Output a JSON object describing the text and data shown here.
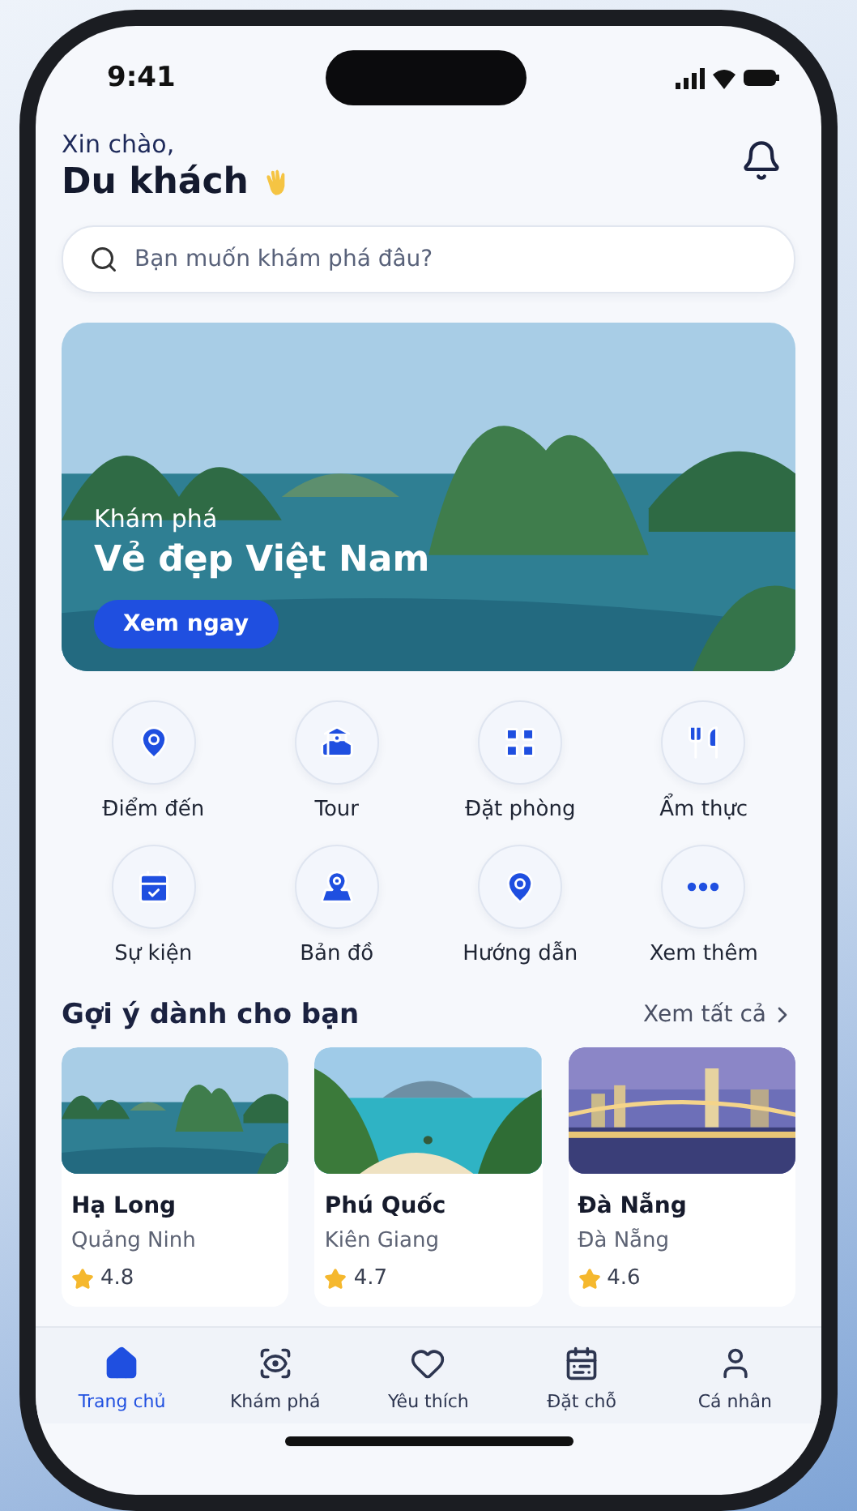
{
  "status_bar": {
    "time": "9:41"
  },
  "header": {
    "greeting": "Xin chào,",
    "name": "Du khách"
  },
  "search": {
    "placeholder": "Bạn muốn khám phá đâu?"
  },
  "hero": {
    "kicker": "Khám phá",
    "title": "Vẻ đẹp Việt Nam",
    "button": "Xem ngay"
  },
  "categories": [
    {
      "label": "Điểm đến",
      "kind": "pin"
    },
    {
      "label": "Tour",
      "kind": "tour"
    },
    {
      "label": "Đặt phòng",
      "kind": "booking"
    },
    {
      "label": "Ẩm thực",
      "kind": "food"
    },
    {
      "label": "Sự kiện",
      "kind": "event"
    },
    {
      "label": "Bản đồ",
      "kind": "map"
    },
    {
      "label": "Hướng dẫn",
      "kind": "pin"
    },
    {
      "label": "Xem thêm",
      "kind": "more"
    }
  ],
  "suggestions": {
    "title": "Gợi ý dành cho bạn",
    "see_all": "Xem tất cả",
    "cards": [
      {
        "name": "Hạ Long",
        "region": "Quảng Ninh",
        "rating": "4.8",
        "kind": "bay"
      },
      {
        "name": "Phú Quốc",
        "region": "Kiên Giang",
        "rating": "4.7",
        "kind": "beach"
      },
      {
        "name": "Đà Nẵng",
        "region": "Đà Nẵng",
        "rating": "4.6",
        "kind": "city"
      }
    ]
  },
  "tabs": [
    {
      "label": "Trang chủ",
      "kind": "home",
      "selected": true
    },
    {
      "label": "Khám phá",
      "kind": "explore",
      "selected": false
    },
    {
      "label": "Yêu thích",
      "kind": "favorite",
      "selected": false
    },
    {
      "label": "Đặt chỗ",
      "kind": "booking",
      "selected": false
    },
    {
      "label": "Cá nhân",
      "kind": "profile",
      "selected": false
    }
  ]
}
